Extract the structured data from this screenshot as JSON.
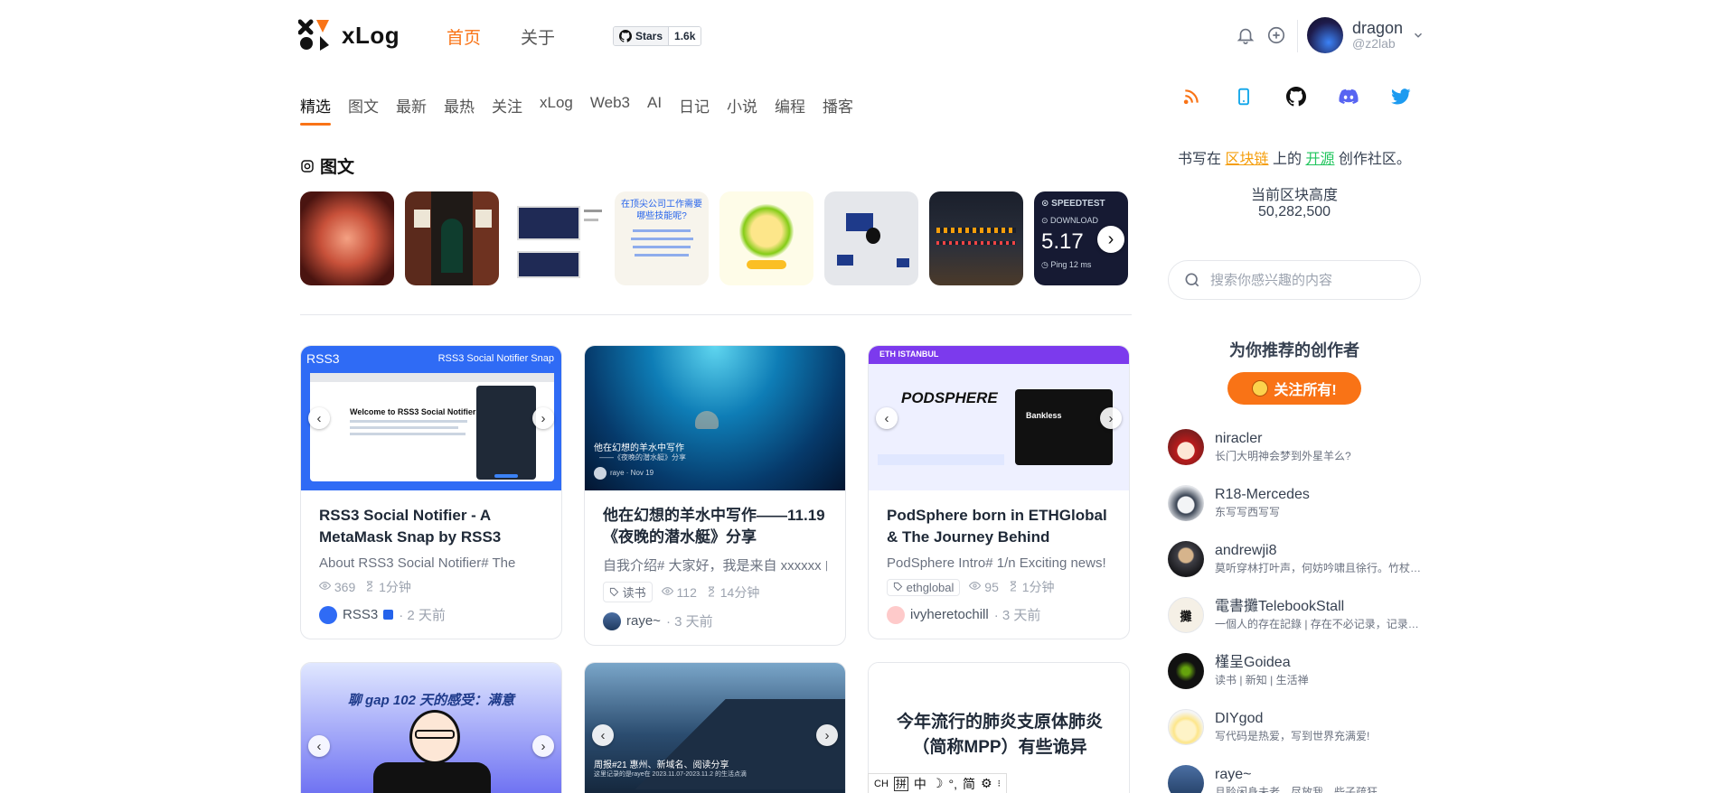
{
  "header": {
    "logo_text": "xLog",
    "nav": [
      "首页",
      "关于"
    ],
    "github_badge": {
      "label": "Stars",
      "count": "1.6k"
    },
    "user": {
      "name": "dragon",
      "handle": "@z2lab"
    }
  },
  "tabs": [
    "精选",
    "图文",
    "最新",
    "最热",
    "关注",
    "xLog",
    "Web3",
    "AI",
    "日记",
    "小说",
    "编程",
    "播客"
  ],
  "section_title": "图文",
  "posts": [
    {
      "title": "RSS3 Social Notifier - A MetaMask Snap by RSS3",
      "excerpt": "About RSS3 Social Notifier# The",
      "views": "369",
      "read_time": "1分钟",
      "author": "RSS3",
      "time": "· 2 天前",
      "cover_brand": "RSS3",
      "cover_caption": "RSS3 Social Notifier Snap",
      "cover_heading": "Welcome to RSS3 Social Notifier - A Me"
    },
    {
      "title": "他在幻想的羊水中写作——11.19《夜晚的潜水艇》分享",
      "excerpt": "自我介绍# 大家好，我是来自 xxxxxx 的",
      "tag": "读书",
      "views": "112",
      "read_time": "14分钟",
      "author": "raye~",
      "time": "· 3 天前",
      "cover_title": "他在幻想的羊水中写作",
      "cover_sub": "——《夜晚的潜水艇》分享",
      "cover_meta": "raye · Nov 19"
    },
    {
      "title": "PodSphere born in ETHGlobal & The Journey Behind",
      "excerpt": "PodSphere Intro# 1/n Exciting news!",
      "tag": "ethglobal",
      "views": "95",
      "read_time": "1分钟",
      "author": "ivyheretochill",
      "time": "· 3 天前",
      "cover_event": "ETH ISTANBUL",
      "cover_brand": "PODSPHERE",
      "cover_panel": "Bankless"
    }
  ],
  "posts_row2": [
    {
      "cover_title": "聊 gap 102 天的感受：满意"
    },
    {
      "cover_title": "周报#21 惠州、新域名、阅读分享",
      "cover_sub": "这里记录的是raye在 2023.11.07-2023.11.2 的生活点滴"
    },
    {
      "title": "今年流行的肺炎支原体肺炎（简称MPP）有些诡异"
    }
  ],
  "sidebar": {
    "slogan_pre": "书写在",
    "slogan_chain": "区块链",
    "slogan_mid": "上的",
    "slogan_oss": "开源",
    "slogan_post": "创作社区。",
    "block_label": "当前区块高度",
    "block_height": "50,282,500",
    "search_placeholder": "搜索你感兴趣的内容",
    "rec_title": "为你推荐的创作者",
    "follow_all": "关注所有!",
    "creators": [
      {
        "name": "niracler",
        "bio": "长门大明神会梦到外星羊么?"
      },
      {
        "name": "R18-Mercedes",
        "bio": "东写写西写写"
      },
      {
        "name": "andrewji8",
        "bio": "莫听穿林打叶声，何妨吟啸且徐行。竹杖芒鞋轻胜马"
      },
      {
        "name": "電書攤TelebookStall",
        "bio": "一個人的存在記錄 | 存在不必记录，记录我的存在"
      },
      {
        "name": "槿呈Goidea",
        "bio": "读书 | 新知 | 生活禅"
      },
      {
        "name": "DIYgod",
        "bio": "写代码是热爱，写到世界充满爱!"
      },
      {
        "name": "raye~",
        "bio": "且聆闲身未老，尽放我、些子疏狂。"
      }
    ]
  },
  "ime": {
    "lang": "CH",
    "items": [
      "拼",
      "中",
      "简"
    ]
  },
  "colors": {
    "accent": "#f97316",
    "chain": "#f59e0b",
    "oss": "#22c55e"
  }
}
